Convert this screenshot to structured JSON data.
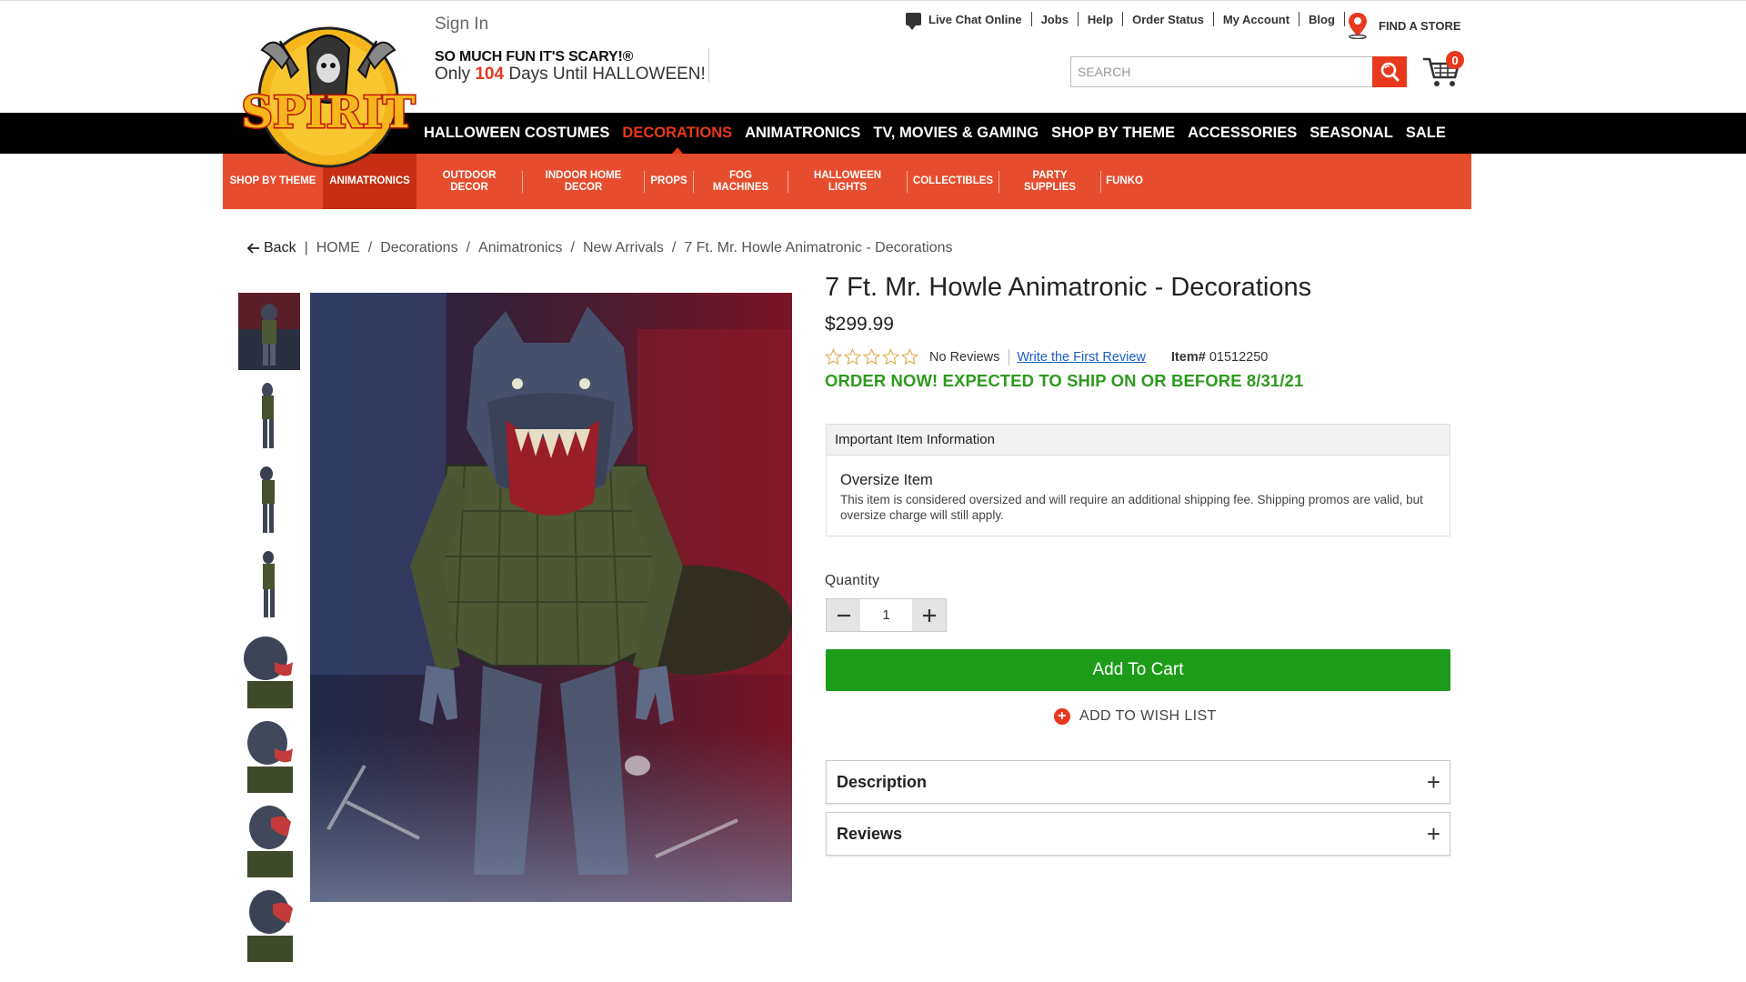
{
  "header": {
    "sign_in": "Sign In",
    "tagline": "SO MUCH FUN IT'S SCARY!®",
    "countdown_prefix": "Only",
    "countdown_days": "104",
    "countdown_suffix": "Days Until HALLOWEEN!",
    "utility_links": [
      "Live Chat Online",
      "Jobs",
      "Help",
      "Order Status",
      "My Account",
      "Blog"
    ],
    "find_store": "FIND A STORE",
    "search_placeholder": "SEARCH",
    "cart_count": "0",
    "logo_text": "SPIRIT"
  },
  "main_nav": {
    "items": [
      "HALLOWEEN COSTUMES",
      "DECORATIONS",
      "ANIMATRONICS",
      "TV, MOVIES & GAMING",
      "SHOP BY THEME",
      "ACCESSORIES",
      "SEASONAL",
      "SALE"
    ],
    "active": "DECORATIONS"
  },
  "sub_nav": {
    "items": [
      "SHOP BY THEME",
      "ANIMATRONICS",
      "OUTDOOR DECOR",
      "INDOOR HOME DECOR",
      "PROPS",
      "FOG MACHINES",
      "HALLOWEEN LIGHTS",
      "COLLECTIBLES",
      "PARTY SUPPLIES",
      "FUNKO"
    ],
    "active": "ANIMATRONICS"
  },
  "breadcrumb": {
    "back": "Back",
    "items": [
      "HOME",
      "Decorations",
      "Animatronics",
      "New Arrivals",
      "7 Ft. Mr. Howle Animatronic - Decorations"
    ]
  },
  "product": {
    "title": "7 Ft. Mr. Howle Animatronic - Decorations",
    "price": "$299.99",
    "rating": 0,
    "review_count_text": "No Reviews",
    "write_review": "Write the First Review",
    "item_label": "Item#",
    "item_number": "01512250",
    "ship_message": "ORDER NOW! EXPECTED TO SHIP ON OR BEFORE 8/31/21",
    "info_heading": "Important Item Information",
    "info_title": "Oversize Item",
    "info_text": "This item is considered oversized and will require an additional shipping fee. Shipping promos are valid, but oversize charge will still apply.",
    "quantity_label": "Quantity",
    "quantity": "1",
    "add_to_cart": "Add To Cart",
    "wishlist": "ADD TO WISH LIST",
    "accordions": [
      "Description",
      "Reviews"
    ]
  },
  "gallery": {
    "thumbnail_count": 8,
    "active_index": 0
  },
  "colors": {
    "brand_orange": "#e64d2e",
    "brand_red": "#e8391e",
    "add_to_cart_green": "#1d9c1a",
    "ship_green": "#2e9a1e",
    "nav_black": "#000000"
  }
}
